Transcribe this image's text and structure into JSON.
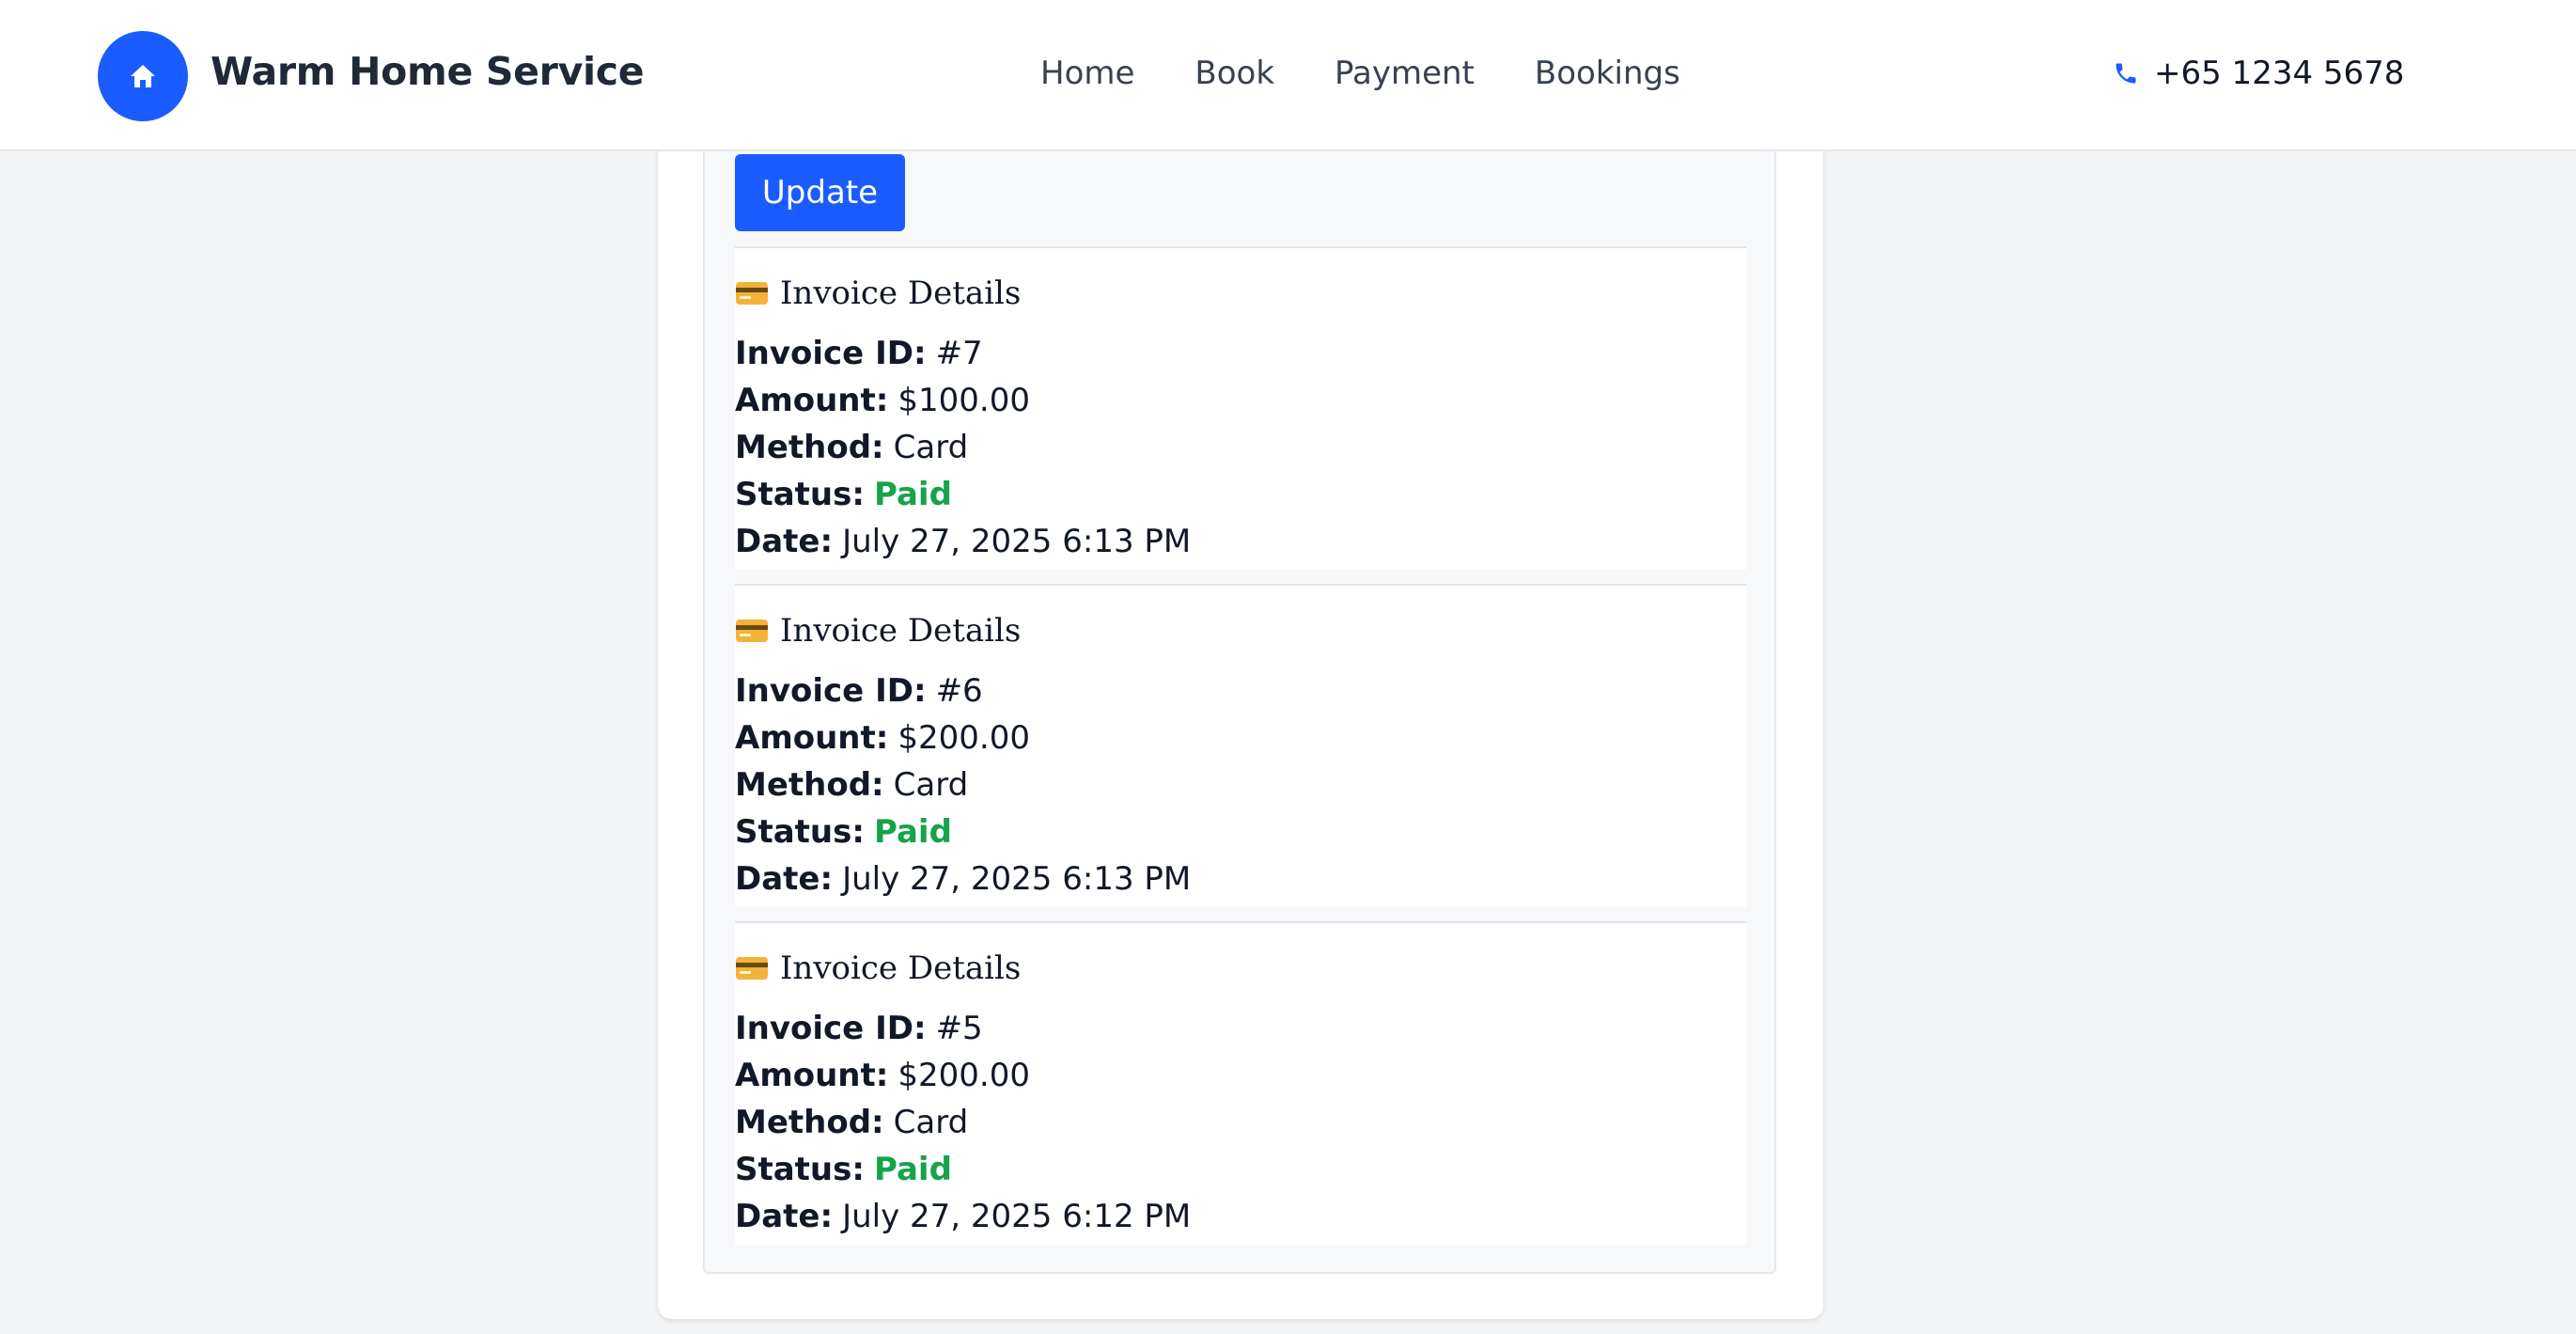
{
  "brand": {
    "name": "Warm Home Service",
    "icon": "home-icon",
    "color": "#1a5cff"
  },
  "nav": {
    "items": [
      {
        "label": "Home"
      },
      {
        "label": "Book"
      },
      {
        "label": "Payment"
      },
      {
        "label": "Bookings"
      }
    ]
  },
  "contact": {
    "phone": "+65 1234 5678",
    "icon": "phone-icon"
  },
  "form": {
    "update_label": "Update"
  },
  "invoices": [
    {
      "title": "Invoice Details",
      "id_label": "Invoice ID:",
      "id": "#7",
      "amount_label": "Amount:",
      "amount": "$100.00",
      "method_label": "Method:",
      "method": "Card",
      "status_label": "Status:",
      "status": "Paid",
      "date_label": "Date:",
      "date": "July 27, 2025 6:13 PM"
    },
    {
      "title": "Invoice Details",
      "id_label": "Invoice ID:",
      "id": "#6",
      "amount_label": "Amount:",
      "amount": "$200.00",
      "method_label": "Method:",
      "method": "Card",
      "status_label": "Status:",
      "status": "Paid",
      "date_label": "Date:",
      "date": "July 27, 2025 6:13 PM"
    },
    {
      "title": "Invoice Details",
      "id_label": "Invoice ID:",
      "id": "#5",
      "amount_label": "Amount:",
      "amount": "$200.00",
      "method_label": "Method:",
      "method": "Card",
      "status_label": "Status:",
      "status": "Paid",
      "date_label": "Date:",
      "date": "July 27, 2025 6:12 PM"
    }
  ],
  "colors": {
    "accent": "#1a5cff",
    "paid": "#16a34a"
  }
}
